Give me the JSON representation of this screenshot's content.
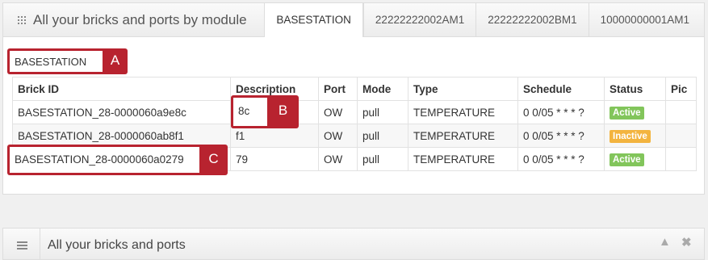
{
  "module_panel": {
    "title": "All your bricks and ports by module",
    "tabs": [
      "BASESTATION",
      "22222222002AM1",
      "22222222002BM1",
      "10000000001AM1"
    ],
    "filter_value": "BASESTATION",
    "columns": [
      "Brick ID",
      "Description",
      "Port",
      "Mode",
      "Type",
      "Schedule",
      "Status",
      "Pic"
    ],
    "rows": [
      {
        "brick_id": "BASESTATION_28-0000060a9e8c",
        "description": "8c",
        "port": "OW",
        "mode": "pull",
        "type": "TEMPERATURE",
        "schedule": "0 0/05 * * * ?",
        "status": "Active",
        "pic": ""
      },
      {
        "brick_id": "BASESTATION_28-0000060ab8f1",
        "description": "f1",
        "port": "OW",
        "mode": "pull",
        "type": "TEMPERATURE",
        "schedule": "0 0/05 * * * ?",
        "status": "Inactive",
        "pic": ""
      },
      {
        "brick_id": "BASESTATION_28-0000060a0279",
        "description": "79",
        "port": "OW",
        "mode": "pull",
        "type": "TEMPERATURE",
        "schedule": "0 0/05 * * * ?",
        "status": "Active",
        "pic": ""
      }
    ]
  },
  "callouts": {
    "a": "A",
    "b": "B",
    "c": "C"
  },
  "bricks_panel": {
    "title": "All your bricks and ports",
    "collapse_icon": "chevron-up-icon",
    "close_icon": "close-icon"
  },
  "colors": {
    "callout": "#b8232f",
    "active": "#82c55b",
    "inactive": "#f3b43f"
  }
}
